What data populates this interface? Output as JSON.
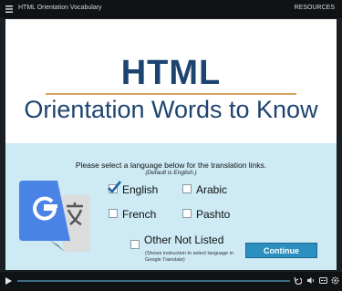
{
  "titlebar": {
    "title": "HTML Orientation Vocabulary",
    "resources": "RESOURCES"
  },
  "slide": {
    "title": "HTML",
    "subtitle": "Orientation Words to Know",
    "instruction": "Please select a language below for the translation links.",
    "default_note": "(Default is English.)",
    "languages": [
      {
        "label": "English",
        "checked": true
      },
      {
        "label": "Arabic",
        "checked": false
      },
      {
        "label": "French",
        "checked": false
      },
      {
        "label": "Pashto",
        "checked": false
      }
    ],
    "other": {
      "label": "Other Not Listed",
      "note": "(Shows instruction to select language in Google Translate)"
    },
    "continue_label": "Continue"
  },
  "colors": {
    "title": "#1d4470",
    "rule": "#d9a35f",
    "panel": "#cdeaf5",
    "button": "#2b8fbf",
    "check": "#1d64a8"
  },
  "icons": [
    "menu-icon",
    "google-translate-icon",
    "play-icon",
    "rewind-icon",
    "volume-icon",
    "captions-icon",
    "settings-icon"
  ]
}
